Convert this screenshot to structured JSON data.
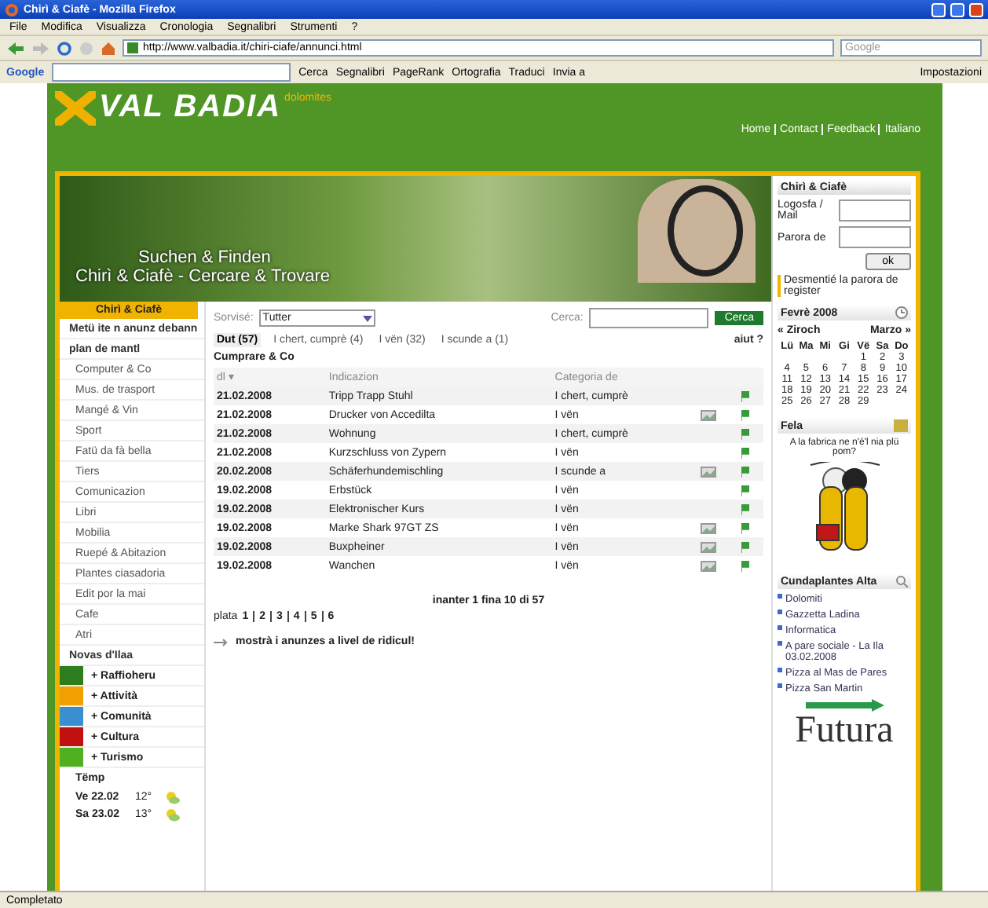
{
  "window": {
    "title": "Chirì & Ciafè - Mozilla Firefox"
  },
  "menu": [
    "File",
    "Modifica",
    "Visualizza",
    "Cronologia",
    "Segnalibri",
    "Strumenti",
    "?"
  ],
  "address": {
    "url": "http://www.valbadia.it/chiri-ciafe/annunci.html"
  },
  "web_search": {
    "placeholder": "Google"
  },
  "google_toolbar": {
    "label": "Google",
    "items": [
      "Cerca",
      "Segnalibri",
      "PageRank",
      "Ortografia",
      "Traduci",
      "Invia a"
    ],
    "settings": "Impostazioni"
  },
  "site": {
    "logo": "VAL BADIA",
    "logo_tag": "dolomites",
    "links": [
      "Home",
      "Contact",
      "Feedback",
      "Italiano"
    ]
  },
  "banner": {
    "line1": "Suchen & Finden",
    "line2": "Chirì & Ciafè - Cercare & Trovare"
  },
  "login": {
    "title": "Chirì & Ciafè",
    "user_label": "Logosfa / Mail",
    "password_label": "Parora de",
    "button": "ok",
    "forgot": "Desmentié la parora de register"
  },
  "sidebar": {
    "header": "Chirì & Ciafè",
    "items": [
      {
        "label": "Metü ite n anunz debann",
        "kind": "heading"
      },
      {
        "label": "plan de mantl",
        "kind": "heading"
      },
      {
        "label": "Computer & Co",
        "kind": "item"
      },
      {
        "label": "Mus. de trasport",
        "kind": "item"
      },
      {
        "label": "Mangé & Vin",
        "kind": "item"
      },
      {
        "label": "Sport",
        "kind": "item"
      },
      {
        "label": "Fatü da fà bella",
        "kind": "item"
      },
      {
        "label": "Tiers",
        "kind": "item"
      },
      {
        "label": "Comunicazion",
        "kind": "item"
      },
      {
        "label": "Libri",
        "kind": "item"
      },
      {
        "label": "Mobilia",
        "kind": "item"
      },
      {
        "label": "Ruepé & Abitazion",
        "kind": "item"
      },
      {
        "label": "Plantes ciasadoria",
        "kind": "item"
      },
      {
        "label": "Edit por la mai",
        "kind": "item"
      },
      {
        "label": "Cafe",
        "kind": "item"
      },
      {
        "label": "Atri",
        "kind": "item"
      },
      {
        "label": "Novas d'Ilaa",
        "kind": "heading"
      }
    ],
    "sections": [
      {
        "label": "+ Raffioheru",
        "color": "#2e7d1e"
      },
      {
        "label": "+ Attività",
        "color": "#f0a000"
      },
      {
        "label": "+ Comunità",
        "color": "#3a8fd0"
      },
      {
        "label": "+ Cultura",
        "color": "#c01010"
      },
      {
        "label": "+ Turismo",
        "color": "#50b020"
      }
    ],
    "weather": {
      "title": "Tëmp",
      "days": [
        {
          "day": "Ve 22.02",
          "temp": "12°"
        },
        {
          "day": "Sa 23.02",
          "temp": "13°"
        }
      ]
    }
  },
  "listing": {
    "filter_label": "Sorvisé:",
    "filter_value": "Tutter",
    "search_label": "Cerca:",
    "search_button": "Cerca",
    "tabs": [
      {
        "label": "Dut (57)",
        "selected": true
      },
      {
        "label": "I chert, cumprè (4)",
        "selected": false
      },
      {
        "label": "I vën (32)",
        "selected": false
      },
      {
        "label": "I scunde a (1)",
        "selected": false
      }
    ],
    "help": "aiut ?",
    "heading": "Cumprare & Co",
    "columns": [
      "dl ▾",
      "Indicazion",
      "Categoria de"
    ],
    "rows": [
      {
        "date": "21.02.2008",
        "title": "Tripp Trapp Stuhl",
        "category": "I chert, cumprè",
        "photo": false
      },
      {
        "date": "21.02.2008",
        "title": "Drucker von Accedilta",
        "category": "I vën",
        "photo": true
      },
      {
        "date": "21.02.2008",
        "title": "Wohnung",
        "category": "I chert, cumprè",
        "photo": false
      },
      {
        "date": "21.02.2008",
        "title": "Kurzschluss von Zypern",
        "category": "I vën",
        "photo": false
      },
      {
        "date": "20.02.2008",
        "title": "Schäferhundemischling",
        "category": "I scunde a",
        "photo": true
      },
      {
        "date": "19.02.2008",
        "title": "Erbstück",
        "category": "I vën",
        "photo": false
      },
      {
        "date": "19.02.2008",
        "title": "Elektronischer Kurs",
        "category": "I vën",
        "photo": false
      },
      {
        "date": "19.02.2008",
        "title": "Marke Shark 97GT ZS",
        "category": "I vën",
        "photo": true
      },
      {
        "date": "19.02.2008",
        "title": "Buxpheiner",
        "category": "I vën",
        "photo": true
      },
      {
        "date": "19.02.2008",
        "title": "Wanchen",
        "category": "I vën",
        "photo": true
      }
    ],
    "range": "inanter 1 fina 10 di 57",
    "pages_label": "plata",
    "pages": [
      "1",
      "2",
      "3",
      "4",
      "5",
      "6"
    ],
    "more_link": "mostrà i anunzes a livel de ridicul!"
  },
  "calendar": {
    "title": "Fevrè 2008",
    "prev": "« Ziroch",
    "next": "Marzo »",
    "weekdays": [
      "Lü",
      "Ma",
      "Mi",
      "Gi",
      "Vë",
      "Sa",
      "Do"
    ],
    "weeks": [
      [
        "1",
        "2",
        "3"
      ],
      [
        "4",
        "5",
        "6",
        "7",
        "8",
        "9",
        "10"
      ],
      [
        "11",
        "12",
        "13",
        "14",
        "15",
        "16",
        "17"
      ],
      [
        "18",
        "19",
        "20",
        "21",
        "22",
        "23",
        "24"
      ],
      [
        "25",
        "26",
        "27",
        "28",
        "29"
      ]
    ]
  },
  "cartoon": {
    "title": "Fela",
    "caption": "A la fabrica ne n'é'l nia plü pom?"
  },
  "links_box": {
    "title": "Cundaplantes Alta",
    "items": [
      "Dolomiti",
      "Gazzetta Ladina",
      "Informatica",
      "A pare sociale - La Ila 03.02.2008",
      "Pizza al Mas de Pares",
      "Pizza San Martin"
    ]
  },
  "sponsor": {
    "logo": "Futura"
  },
  "status_bar": {
    "text": "Completato"
  }
}
